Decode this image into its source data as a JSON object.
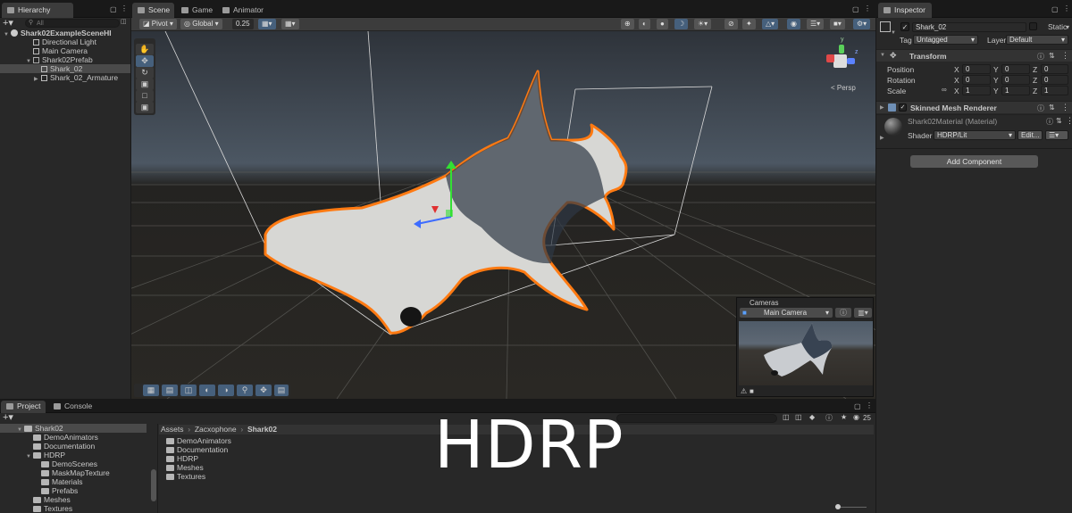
{
  "hierarchy": {
    "tab_label": "Hierarchy",
    "search_placeholder": "All",
    "items": [
      {
        "label": "Shark02ExampleSceneHI",
        "kind": "scene"
      },
      {
        "label": "Directional Light",
        "kind": "object"
      },
      {
        "label": "Main Camera",
        "kind": "object"
      },
      {
        "label": "Shark02Prefab",
        "kind": "prefab"
      },
      {
        "label": "Shark_02",
        "kind": "prefab"
      },
      {
        "label": "Shark_02_Armature",
        "kind": "prefab"
      }
    ]
  },
  "scene": {
    "tabs": [
      "Scene",
      "Game",
      "Animator"
    ],
    "toolbar": {
      "pivot": "Pivot",
      "global": "Global",
      "snap": "0.25"
    },
    "persp_label": "< Persp",
    "tools": [
      "hand-tool",
      "move-tool",
      "rotate-tool",
      "scale-tool",
      "rect-tool",
      "transform-tool"
    ],
    "camera_overlay": {
      "title": "Cameras",
      "camera": "Main Camera"
    }
  },
  "inspector": {
    "tab_label": "Inspector",
    "object_name": "Shark_02",
    "static_label": "Static",
    "tag_label": "Tag",
    "tag_value": "Untagged",
    "layer_label": "Layer",
    "layer_value": "Default",
    "transform": {
      "title": "Transform",
      "rows": [
        {
          "label": "Position",
          "x": "0",
          "y": "0",
          "z": "0"
        },
        {
          "label": "Rotation",
          "x": "0",
          "y": "0",
          "z": "0"
        },
        {
          "label": "Scale",
          "x": "1",
          "y": "1",
          "z": "1"
        }
      ]
    },
    "renderer": {
      "title": "Skinned Mesh Renderer"
    },
    "material": {
      "name": "Shark02Material (Material)",
      "shader_label": "Shader",
      "shader_value": "HDRP/Lit",
      "edit_label": "Edit..."
    },
    "add_component": "Add Component"
  },
  "project": {
    "tabs": [
      "Project",
      "Console"
    ],
    "tree": [
      {
        "label": "Shark02",
        "level": 0
      },
      {
        "label": "DemoAnimators",
        "level": 1
      },
      {
        "label": "Documentation",
        "level": 1
      },
      {
        "label": "HDRP",
        "level": 1
      },
      {
        "label": "DemoScenes",
        "level": 2
      },
      {
        "label": "MaskMapTexture",
        "level": 2
      },
      {
        "label": "Materials",
        "level": 2
      },
      {
        "label": "Prefabs",
        "level": 2
      },
      {
        "label": "Meshes",
        "level": 1
      },
      {
        "label": "Textures",
        "level": 1
      }
    ],
    "breadcrumb": [
      "Assets",
      "Zacxophone",
      "Shark02"
    ],
    "contents": [
      "DemoAnimators",
      "Documentation",
      "HDRP",
      "Meshes",
      "Textures"
    ],
    "hidden_count": "25"
  },
  "overlay_title": "HDRP",
  "colors": {
    "selection_outline": "#ff7a12",
    "accent": "#46607c"
  }
}
